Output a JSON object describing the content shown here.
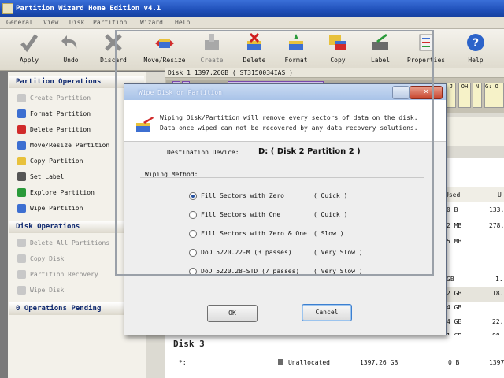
{
  "window": {
    "title": "Partition Wizard Home Edition v4.1"
  },
  "menu": [
    "General",
    "View",
    "Disk",
    "Partition",
    "Wizard",
    "Help"
  ],
  "toolbar": [
    {
      "label": "Apply",
      "icon": "apply-check-icon",
      "enabled": true
    },
    {
      "label": "Undo",
      "icon": "undo-arrow-icon",
      "enabled": true
    },
    {
      "label": "Discard",
      "icon": "discard-x-icon",
      "enabled": true
    },
    {
      "label": "Move/Resize",
      "icon": "move-resize-icon",
      "enabled": true
    },
    {
      "label": "Create",
      "icon": "create-partition-icon",
      "enabled": false
    },
    {
      "label": "Delete",
      "icon": "delete-partition-icon",
      "enabled": true
    },
    {
      "label": "Format",
      "icon": "format-partition-icon",
      "enabled": true
    },
    {
      "label": "Copy",
      "icon": "copy-partition-icon",
      "enabled": true
    },
    {
      "label": "Label",
      "icon": "label-icon",
      "enabled": true
    },
    {
      "label": "Properties",
      "icon": "properties-icon",
      "enabled": true
    },
    {
      "label": "Help",
      "icon": "help-icon",
      "enabled": true
    }
  ],
  "left_panel": {
    "partition_ops_title": "Partition Operations",
    "partition_ops": [
      {
        "label": "Create Partition",
        "enabled": false
      },
      {
        "label": "Format Partition",
        "enabled": true
      },
      {
        "label": "Delete Partition",
        "enabled": true
      },
      {
        "label": "Move/Resize Partition",
        "enabled": true
      },
      {
        "label": "Copy Partition",
        "enabled": true
      },
      {
        "label": "Set Label",
        "enabled": true
      },
      {
        "label": "Explore Partition",
        "enabled": true
      },
      {
        "label": "Wipe Partition",
        "enabled": true
      }
    ],
    "disk_ops_title": "Disk Operations",
    "disk_ops": [
      {
        "label": "Delete All Partitions",
        "enabled": false
      },
      {
        "label": "Copy Disk",
        "enabled": false
      },
      {
        "label": "Partition Recovery",
        "enabled": false
      },
      {
        "label": "Wipe Disk",
        "enabled": false
      }
    ],
    "pending_title": "0 Operations Pending"
  },
  "disk_map": {
    "disk_header": "Disk 1 1397.26GB ( ST3150034IAS )",
    "right_cells": [
      "J",
      "OH",
      "N",
      "G: O"
    ]
  },
  "table": {
    "used_header": "Used",
    "unused_header": "U",
    "rows": [
      {
        "used": "0 B",
        "unused": "133."
      },
      {
        "used": "2 MB",
        "unused": "278."
      },
      {
        "used": "5 MB",
        "unused": ""
      },
      {
        "used": "GB",
        "unused": "1."
      },
      {
        "used": "2 GB",
        "unused": "18."
      },
      {
        "used": "4 GB",
        "unused": ""
      },
      {
        "used": "4 GB",
        "unused": "22."
      },
      {
        "used": "1 GB",
        "unused": "88."
      }
    ],
    "disk3_title": "Disk 3",
    "disk3_row": {
      "name": "*:",
      "type": "Unallocated",
      "capacity": "1397.26 GB",
      "used": "0 B",
      "unused": "1397."
    }
  },
  "dialog": {
    "title": "Wipe Disk or Partition",
    "message": "Wiping Disk/Partition will remove every sectors of data on the disk. Data once wiped can not be recovered by any data recovery solutions.",
    "dest_label": "Destination Device:",
    "dest_value": "D: ( Disk 2 Partition 2 )",
    "method_label": "Wiping Method:",
    "methods": [
      {
        "label": "Fill Sectors with Zero",
        "speed": "( Quick )",
        "selected": true
      },
      {
        "label": "Fill Sectors with One",
        "speed": "( Quick )",
        "selected": false
      },
      {
        "label": "Fill Sectors with Zero & One",
        "speed": "( Slow )",
        "selected": false
      },
      {
        "label": "DoD 5220.22-M (3 passes)",
        "speed": "( Very Slow )",
        "selected": false
      },
      {
        "label": "DoD 5220.28-STD (7 passes)",
        "speed": "( Very Slow )",
        "selected": false
      }
    ],
    "ok_label": "OK",
    "cancel_label": "Cancel",
    "close_symbol": "×",
    "min_symbol": "–"
  }
}
